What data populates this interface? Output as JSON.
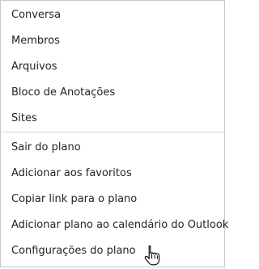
{
  "menu": {
    "primary_items": [
      {
        "label": "Conversa"
      },
      {
        "label": "Membros"
      },
      {
        "label": "Arquivos"
      },
      {
        "label": "Bloco de Anotações"
      },
      {
        "label": "Sites"
      }
    ],
    "secondary_items": [
      {
        "label": "Sair do plano"
      },
      {
        "label": "Adicionar aos favoritos"
      },
      {
        "label": "Copiar link para o plano"
      },
      {
        "label": "Adicionar plano ao calendário do Outlook"
      },
      {
        "label": "Configurações do plano"
      }
    ]
  },
  "cursor": {
    "icon": "hand-pointer-icon"
  }
}
